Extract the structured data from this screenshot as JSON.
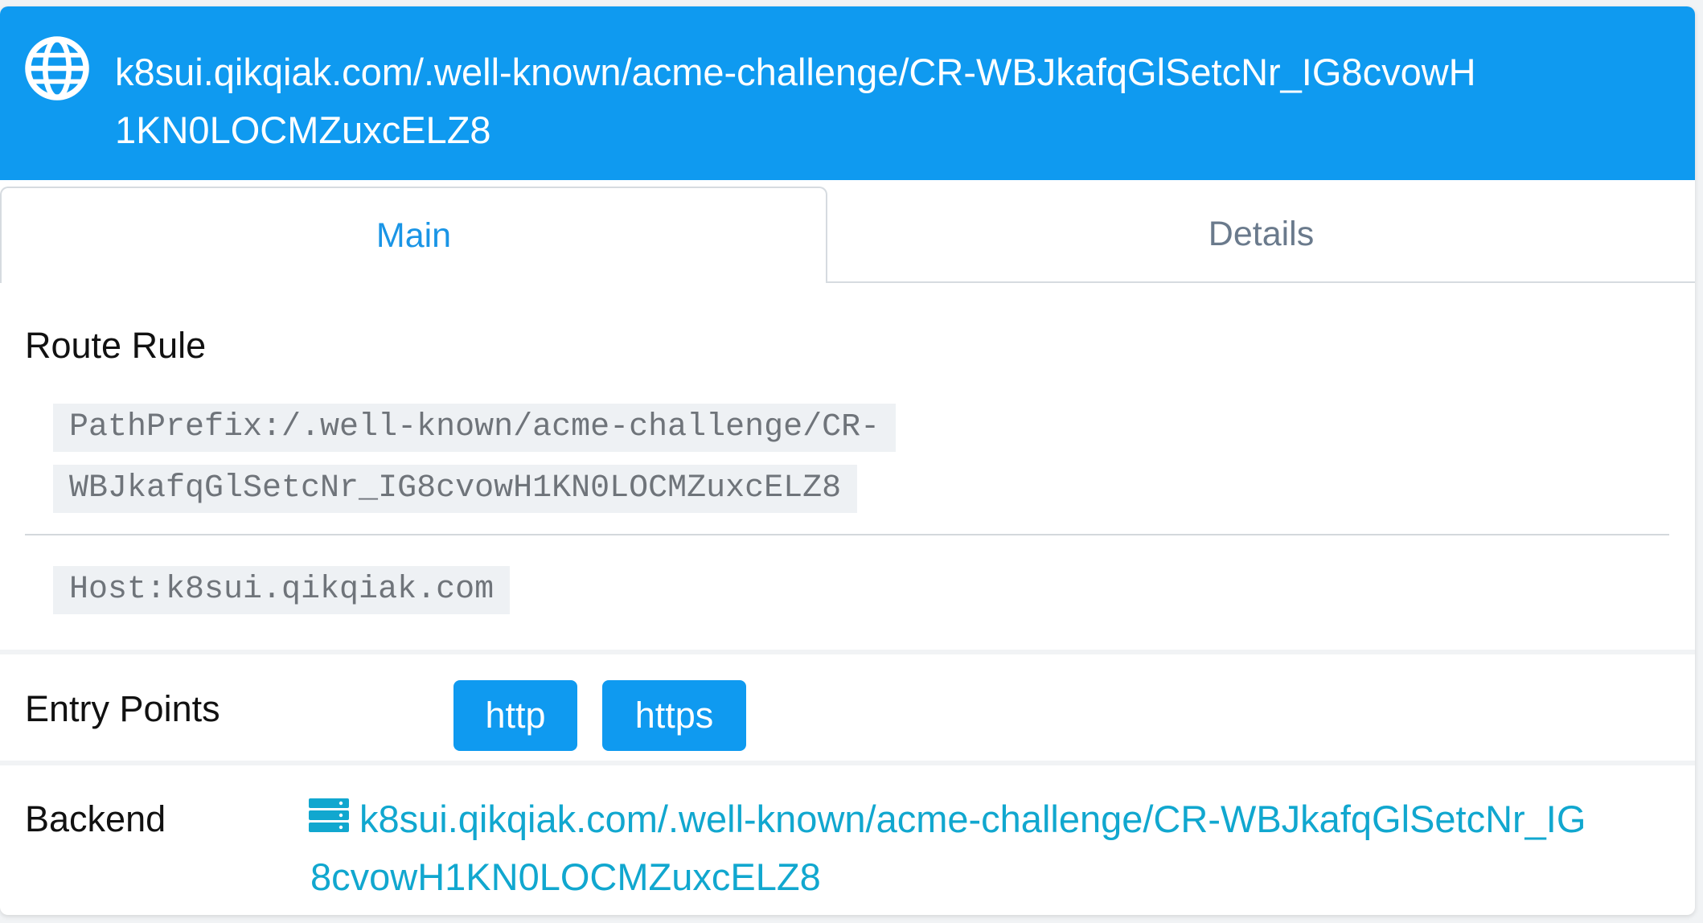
{
  "header": {
    "title_line1": "k8sui.qikqiak.com/.well-known/acme-challenge/CR-",
    "title_line2": "WBJkafqGlSetcNr_IG8cvowH1KN0LOCMZuxcELZ8",
    "icon": "globe-icon"
  },
  "tabs": [
    {
      "label": "Main",
      "active": true
    },
    {
      "label": "Details",
      "active": false
    }
  ],
  "route_rule": {
    "title": "Route Rule",
    "path_line1": "PathPrefix:/.well-known/acme-challenge/CR-",
    "path_line2": "WBJkafqGlSetcNr_IG8cvowH1KN0LOCMZuxcELZ8",
    "host": "Host:k8sui.qikqiak.com"
  },
  "entry_points": {
    "title": "Entry Points",
    "items": [
      "http",
      "https"
    ]
  },
  "backend": {
    "title": "Backend",
    "icon": "server-icon",
    "link": "k8sui.qikqiak.com/.well-known/acme-challenge/CR-WBJkafqGlSetcNr_IG8cvowH1KN0LOCMZuxcELZ8"
  },
  "colors": {
    "accent": "#0f9af0",
    "link": "#11a7cf",
    "code_bg": "#eef1f4"
  }
}
